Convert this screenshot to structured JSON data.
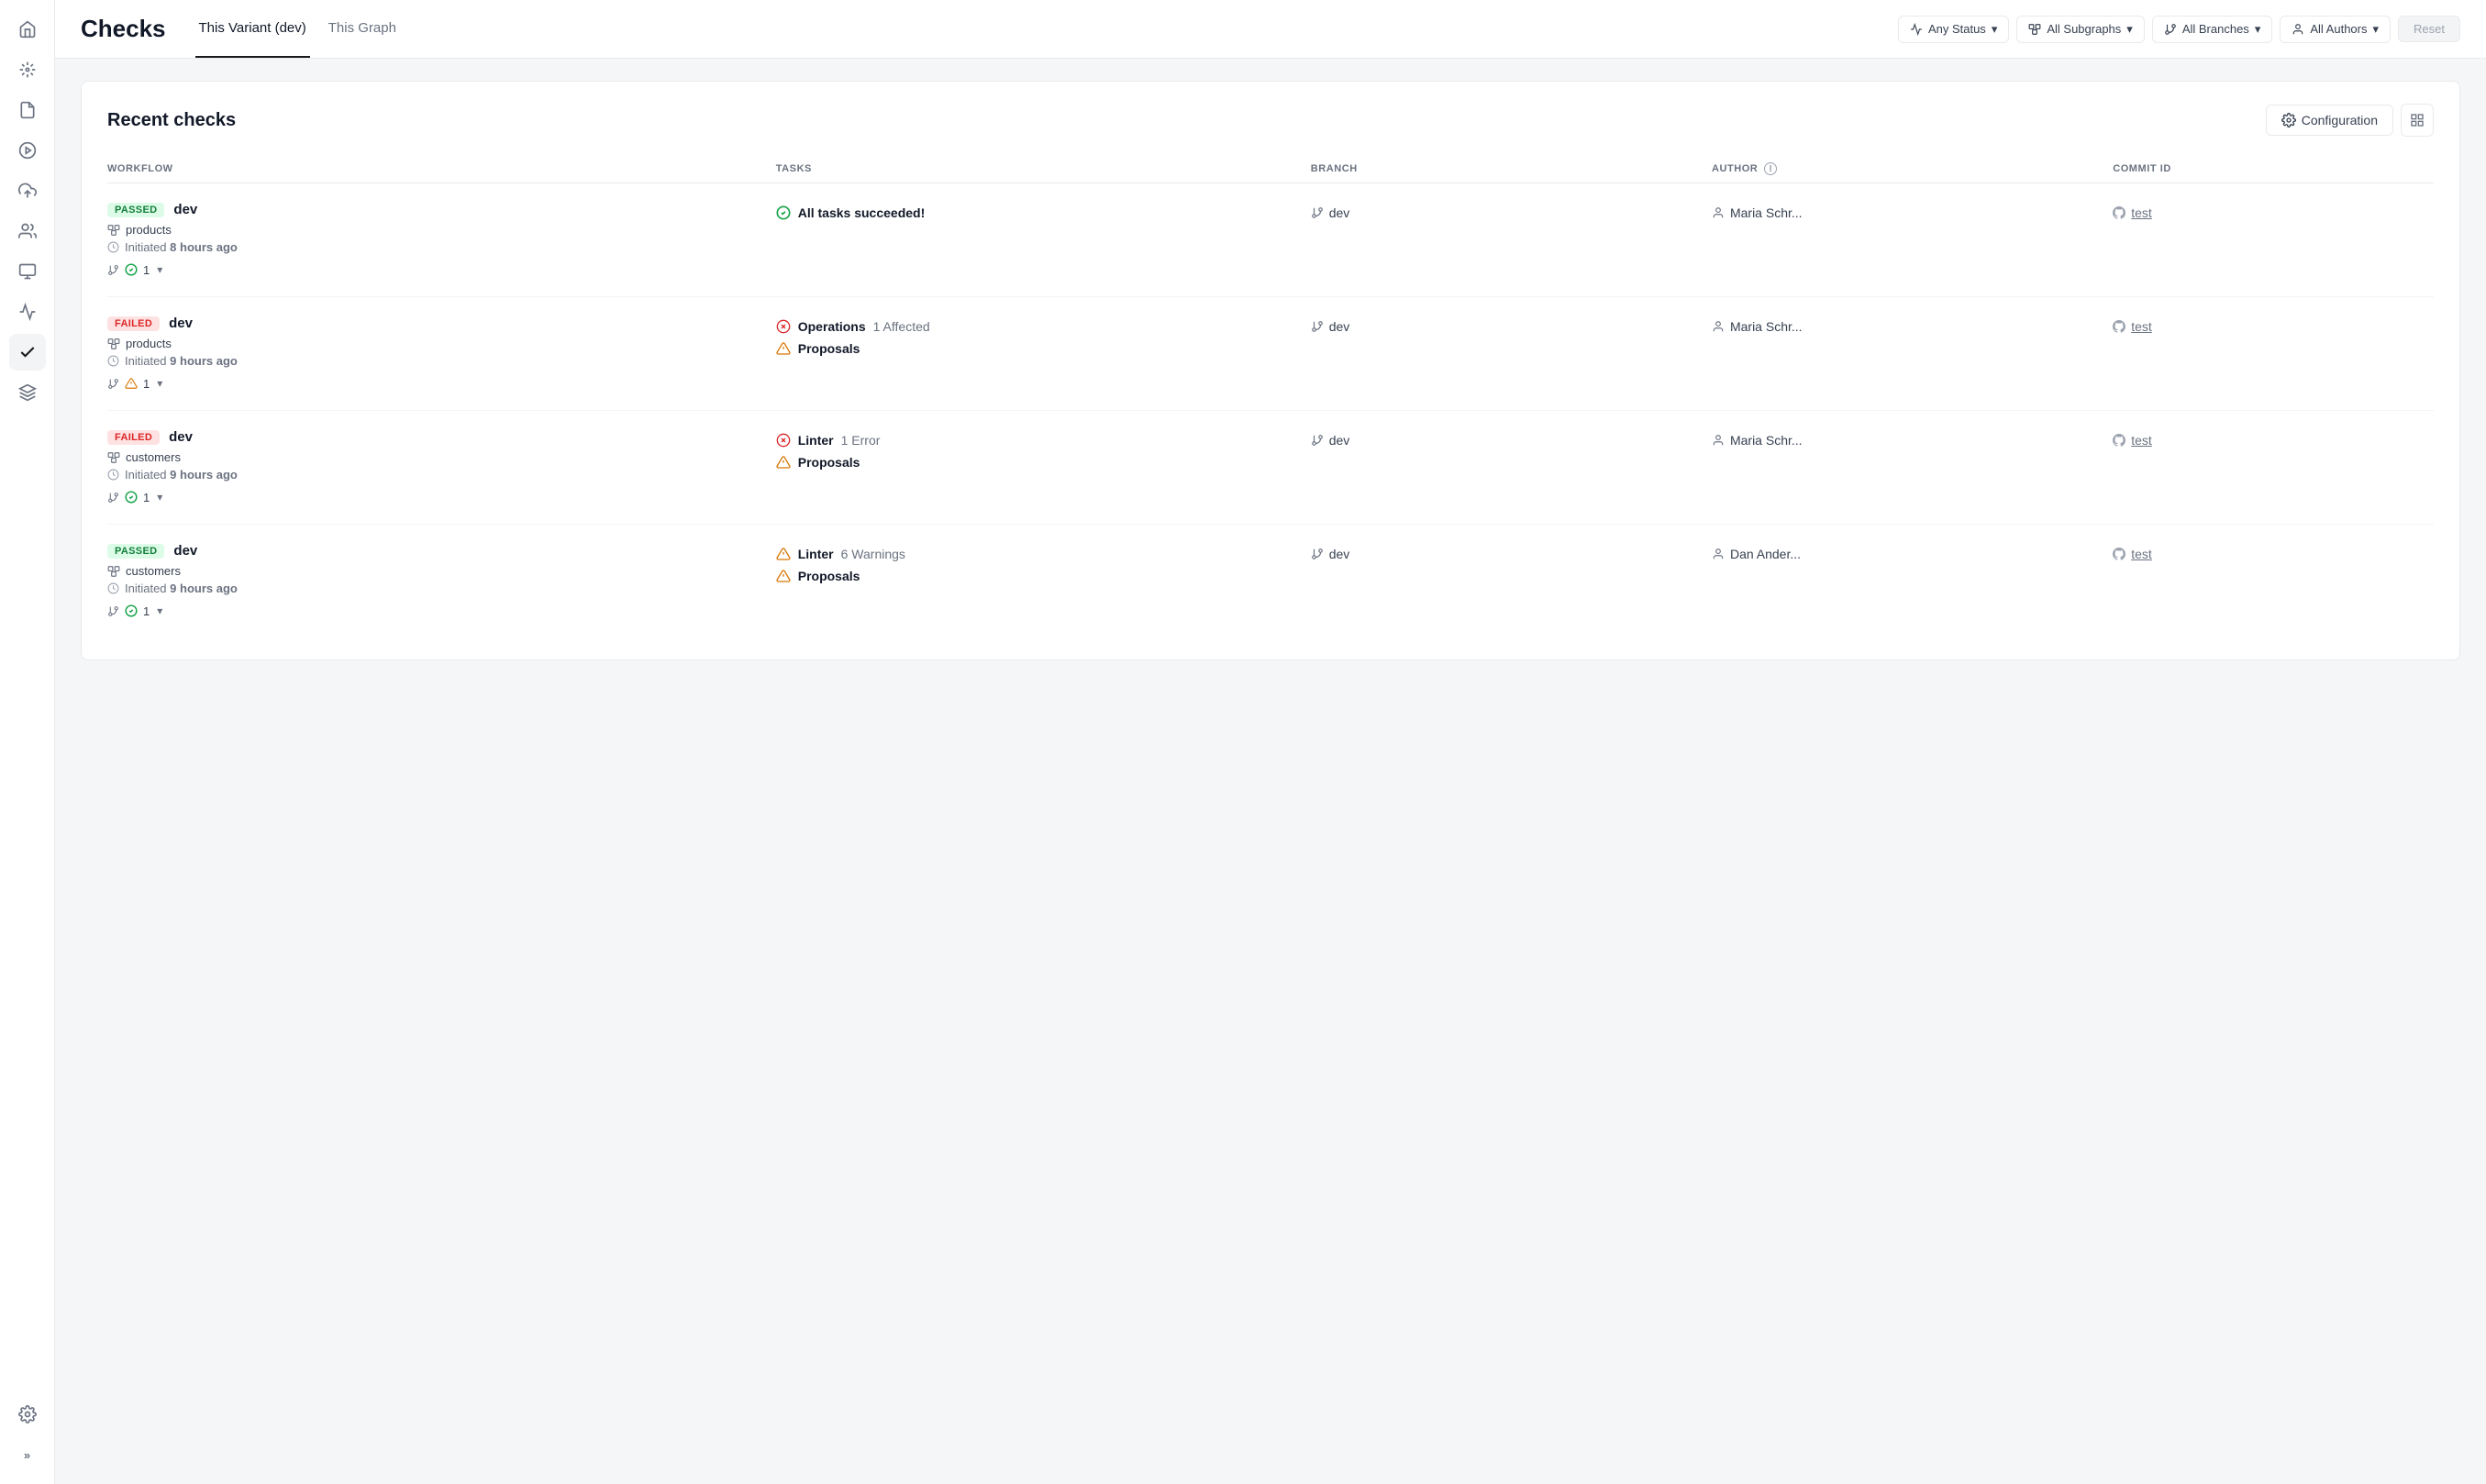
{
  "sidebar": {
    "icons": [
      {
        "name": "rocket-icon",
        "symbol": "🚀",
        "active": false
      },
      {
        "name": "asterisk-icon",
        "symbol": "✳",
        "active": false
      },
      {
        "name": "document-icon",
        "symbol": "📄",
        "active": false
      },
      {
        "name": "play-icon",
        "symbol": "▶",
        "active": false
      },
      {
        "name": "upload-icon",
        "symbol": "⬆",
        "active": false
      },
      {
        "name": "people-icon",
        "symbol": "⚙",
        "active": false
      },
      {
        "name": "monitor-icon",
        "symbol": "🖥",
        "active": false
      },
      {
        "name": "graph-icon",
        "symbol": "〜",
        "active": false
      },
      {
        "name": "checks-icon",
        "symbol": "✓",
        "active": true
      },
      {
        "name": "deploy-icon",
        "symbol": "🚀",
        "active": false
      },
      {
        "name": "settings-icon",
        "symbol": "⚙",
        "active": false
      }
    ],
    "expand_label": "»"
  },
  "header": {
    "title": "Checks",
    "tabs": [
      {
        "label": "This Variant (dev)",
        "active": true
      },
      {
        "label": "This Graph",
        "active": false
      }
    ],
    "filters": [
      {
        "label": "Any Status",
        "icon": "status-icon"
      },
      {
        "label": "All Subgraphs",
        "icon": "subgraph-icon"
      },
      {
        "label": "All Branches",
        "icon": "branch-icon"
      },
      {
        "label": "All Authors",
        "icon": "author-icon"
      }
    ],
    "reset_label": "Reset"
  },
  "main": {
    "title": "Recent checks",
    "config_label": "Configuration",
    "checks": [
      {
        "status": "PASSED",
        "branch_name": "dev",
        "subgraph": "products",
        "initiated": "Initiated 8 hours ago",
        "check_count": "1",
        "check_icon": "success",
        "tasks": [
          {
            "type": "success",
            "name": "All tasks succeeded!",
            "detail": ""
          }
        ],
        "branch": "dev",
        "author": "Maria Schr...",
        "commit": "test"
      },
      {
        "status": "FAILED",
        "branch_name": "dev",
        "subgraph": "products",
        "initiated": "Initiated 9 hours ago",
        "check_count": "1",
        "check_icon": "warning",
        "tasks": [
          {
            "type": "error",
            "name": "Operations",
            "detail": "1 Affected"
          },
          {
            "type": "warning",
            "name": "Proposals",
            "detail": ""
          }
        ],
        "branch": "dev",
        "author": "Maria Schr...",
        "commit": "test"
      },
      {
        "status": "FAILED",
        "branch_name": "dev",
        "subgraph": "customers",
        "initiated": "Initiated 9 hours ago",
        "check_count": "1",
        "check_icon": "success",
        "tasks": [
          {
            "type": "error",
            "name": "Linter",
            "detail": "1 Error"
          },
          {
            "type": "warning",
            "name": "Proposals",
            "detail": ""
          }
        ],
        "branch": "dev",
        "author": "Maria Schr...",
        "commit": "test"
      },
      {
        "status": "PASSED",
        "branch_name": "dev",
        "subgraph": "customers",
        "initiated": "Initiated 9 hours ago",
        "check_count": "1",
        "check_icon": "success",
        "tasks": [
          {
            "type": "warning",
            "name": "Linter",
            "detail": "6 Warnings"
          },
          {
            "type": "warning",
            "name": "Proposals",
            "detail": ""
          }
        ],
        "branch": "dev",
        "author": "Dan Ander...",
        "commit": "test"
      }
    ],
    "columns": [
      "WORKFLOW",
      "TASKS",
      "BRANCH",
      "AUTHOR",
      "COMMIT ID"
    ]
  }
}
